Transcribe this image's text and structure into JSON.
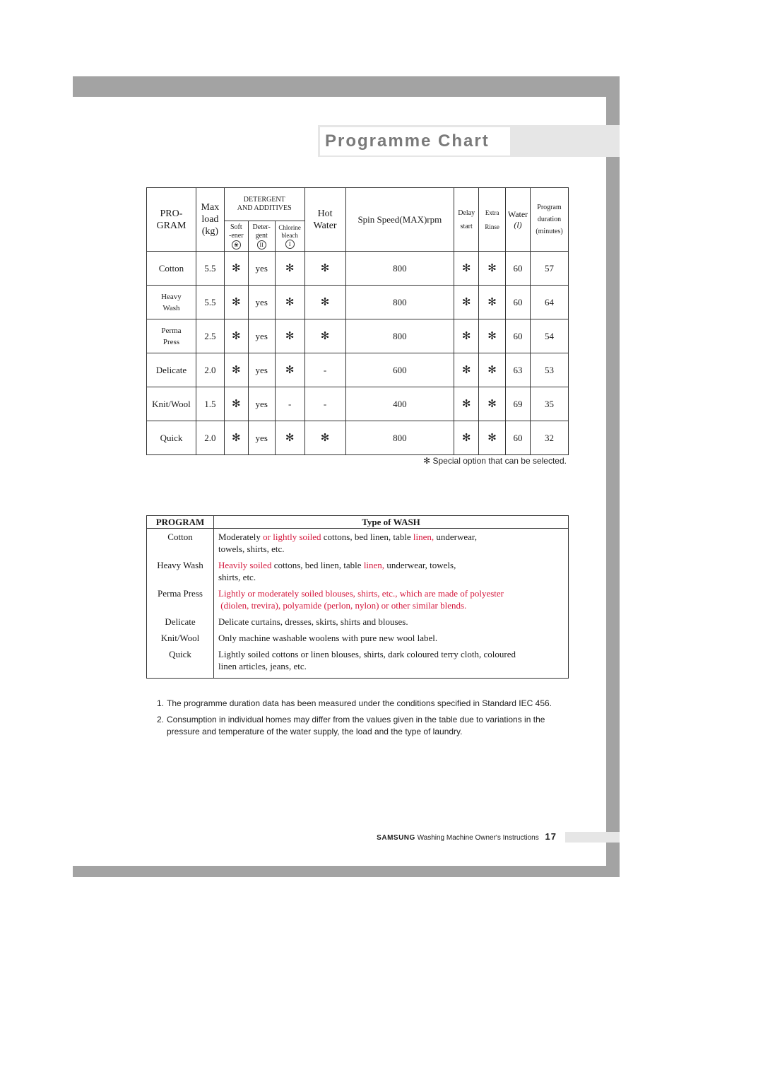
{
  "page": {
    "title": "Programme Chart",
    "colors": {
      "frame": "#a3a3a3",
      "band": "#e6e6e6",
      "title_text": "#7a7a7a",
      "highlight_red": "#d4173c"
    }
  },
  "programme_table": {
    "headers": {
      "program": [
        "PRO-",
        "GRAM"
      ],
      "max_load": [
        "Max",
        "load",
        "(kg)"
      ],
      "detergent_group": [
        "DETERGENT",
        "AND ADDITIVES"
      ],
      "softener": [
        "Soft",
        "-ener"
      ],
      "softener_symbol": "❀",
      "detergent": [
        "Deter-",
        "gent"
      ],
      "detergent_symbol": "II",
      "chlorine": [
        "Chlorine",
        "bleach"
      ],
      "chlorine_symbol": "I",
      "hot_water": [
        "Hot",
        "Water"
      ],
      "spin_speed": "Spin Speed(MAX)rpm",
      "delay_start": [
        "Delay",
        "start"
      ],
      "extra_rinse": [
        "Extra",
        "Rinse"
      ],
      "water": [
        "Water",
        "(l)"
      ],
      "duration": [
        "Program",
        "duration",
        "(minutes)"
      ]
    },
    "rows": [
      {
        "program": "Cotton",
        "program_small": false,
        "max_load": "5.5",
        "softener": "✻",
        "detergent": "yes",
        "chlorine": "✻",
        "hot_water": "✻",
        "spin": "800",
        "delay": "✻",
        "rinse": "✻",
        "water": "60",
        "duration": "57"
      },
      {
        "program": "Heavy Wash",
        "program_lines": [
          "Heavy",
          "Wash"
        ],
        "program_small": true,
        "max_load": "5.5",
        "softener": "✻",
        "detergent": "yes",
        "chlorine": "✻",
        "hot_water": "✻",
        "spin": "800",
        "delay": "✻",
        "rinse": "✻",
        "water": "60",
        "duration": "64"
      },
      {
        "program": "Perma Press",
        "program_lines": [
          "Perma",
          "Press"
        ],
        "program_small": true,
        "max_load": "2.5",
        "softener": "✻",
        "detergent": "yes",
        "chlorine": "✻",
        "hot_water": "✻",
        "spin": "800",
        "delay": "✻",
        "rinse": "✻",
        "water": "60",
        "duration": "54"
      },
      {
        "program": "Delicate",
        "program_small": false,
        "max_load": "2.0",
        "softener": "✻",
        "detergent": "yes",
        "chlorine": "✻",
        "hot_water": "-",
        "spin": "600",
        "delay": "✻",
        "rinse": "✻",
        "water": "63",
        "duration": "53"
      },
      {
        "program": "Knit/Wool",
        "program_small": false,
        "max_load": "1.5",
        "softener": "✻",
        "detergent": "yes",
        "chlorine": "-",
        "hot_water": "-",
        "spin": "400",
        "delay": "✻",
        "rinse": "✻",
        "water": "69",
        "duration": "35"
      },
      {
        "program": "Quick",
        "program_small": false,
        "max_load": "2.0",
        "softener": "✻",
        "detergent": "yes",
        "chlorine": "✻",
        "hot_water": "✻",
        "spin": "800",
        "delay": "✻",
        "rinse": "✻",
        "water": "60",
        "duration": "32"
      }
    ],
    "footnote": "✻ Special option that can be selected."
  },
  "wash_table": {
    "headers": {
      "program": "PROGRAM",
      "type": "Type of  WASH"
    },
    "rows": [
      {
        "program": "Cotton",
        "segments": [
          {
            "text": "Moderately ",
            "red": false
          },
          {
            "text": "or lightly soiled",
            "red": true
          },
          {
            "text": " cottons, bed linen, table ",
            "red": false
          },
          {
            "text": "linen,",
            "red": true
          },
          {
            "text": " underwear,",
            "red": false
          },
          {
            "text": "\ntowels, shirts, etc.",
            "red": false
          }
        ]
      },
      {
        "program": "Heavy Wash",
        "segments": [
          {
            "text": "Heavily soiled",
            "red": true
          },
          {
            "text": " cottons, bed linen, table ",
            "red": false
          },
          {
            "text": "linen,",
            "red": true
          },
          {
            "text": " underwear, towels,\nshirts, etc.",
            "red": false
          }
        ]
      },
      {
        "program": "Perma Press",
        "segments": [
          {
            "text": "Lightly or moderately soiled blouses, shirts, etc., which are made of polyester\n (diolen, trevira), polyamide (perlon, nylon) or other similar blends.",
            "red": true
          }
        ]
      },
      {
        "program": "Delicate",
        "segments": [
          {
            "text": "Delicate curtains, dresses, skirts, shirts and blouses.",
            "red": false
          }
        ]
      },
      {
        "program": "Knit/Wool",
        "segments": [
          {
            "text": "Only machine washable woolens with pure new wool label.",
            "red": false
          }
        ]
      },
      {
        "program": "Quick",
        "segments": [
          {
            "text": "Lightly soiled cottons or linen blouses, shirts, dark coloured terry cloth, coloured\nlinen articles, jeans, etc.",
            "red": false
          }
        ]
      }
    ]
  },
  "notes": [
    {
      "num": "1.",
      "text": "The programme duration data has been measured under the conditions specified in Standard IEC 456."
    },
    {
      "num": "2.",
      "text": "Consumption in individual homes may differ from the values given in the table due to variations in the pressure and temperature of the water supply, the load and the type of laundry."
    }
  ],
  "footer": {
    "brand": "SAMSUNG",
    "text": "Washing Machine Owner's Instructions",
    "page_number": "17"
  }
}
